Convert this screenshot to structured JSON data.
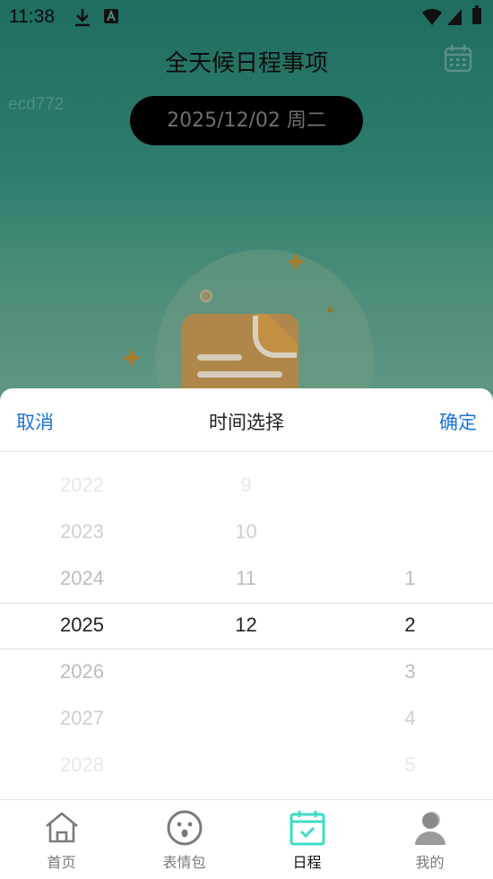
{
  "status": {
    "time": "11:38"
  },
  "header": {
    "title": "全天候日程事项"
  },
  "user": {
    "id": "ecd772"
  },
  "date": {
    "label": "2025/12/02 周二"
  },
  "sheet": {
    "cancel": "取消",
    "title": "时间选择",
    "confirm": "确定"
  },
  "picker": {
    "years": [
      "2022",
      "2023",
      "2024",
      "2025",
      "2026",
      "2027",
      "2028"
    ],
    "months": [
      "9",
      "10",
      "11",
      "12",
      "",
      "",
      ""
    ],
    "days": [
      "",
      "",
      "1",
      "2",
      "3",
      "4",
      "5"
    ]
  },
  "nav": [
    {
      "label": "首页",
      "icon": "home-icon"
    },
    {
      "label": "表情包",
      "icon": "emoji-icon"
    },
    {
      "label": "日程",
      "icon": "calendar-check-icon",
      "active": true
    },
    {
      "label": "我的",
      "icon": "user-icon"
    }
  ],
  "colors": {
    "accent": "#1e73d6",
    "active_tab": "#3ddcc6"
  }
}
